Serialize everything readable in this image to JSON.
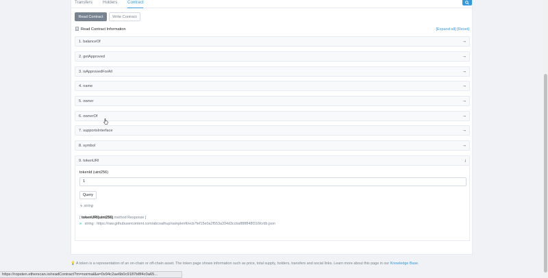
{
  "tabs": [
    {
      "label": "Transfers",
      "active": false
    },
    {
      "label": "Holders",
      "active": false
    },
    {
      "label": "Contract",
      "active": true
    }
  ],
  "subtabs": {
    "read": "Read Contract",
    "write": "Write Contract"
  },
  "info": {
    "title": "Read Contract Information",
    "expand_all": "[Expand all]",
    "reset": "[Reset]"
  },
  "functions": [
    {
      "label": "1. balanceOf"
    },
    {
      "label": "2. getApproved"
    },
    {
      "label": "3. isApprovedForAll"
    },
    {
      "label": "4. name"
    },
    {
      "label": "5. owner"
    },
    {
      "label": "6. ownerOf"
    },
    {
      "label": "7. supportsInterface"
    },
    {
      "label": "8. symbol"
    },
    {
      "label": "9. tokenURI"
    }
  ],
  "expanded": {
    "param_label": "tokenId (uint256)",
    "param_value": "1",
    "query_label": "Query",
    "return_type": "string",
    "response_header_prefix": "[",
    "response_fn": "tokenURI(uint256)",
    "response_method": "method Response",
    "response_header_suffix": "]",
    "response_type": "string :",
    "response_value": "https://raw.githubusercontent.com/abcoathup/samplenft/ecb7fef15e0a2f553a334d3ccbaf88f848f316fc/db.json"
  },
  "footer": {
    "text": "A token is a representation of an on-chain or off-chain asset. The token page shows information such as price, total supply, holders, transfers and social links. Learn more about this page in our",
    "link": "Knowledge Base."
  },
  "status_url": "https://ropsten.etherscan.io/readContract?m=normal&a=0x94c2ae6b0c9187b8f4c0a65..."
}
